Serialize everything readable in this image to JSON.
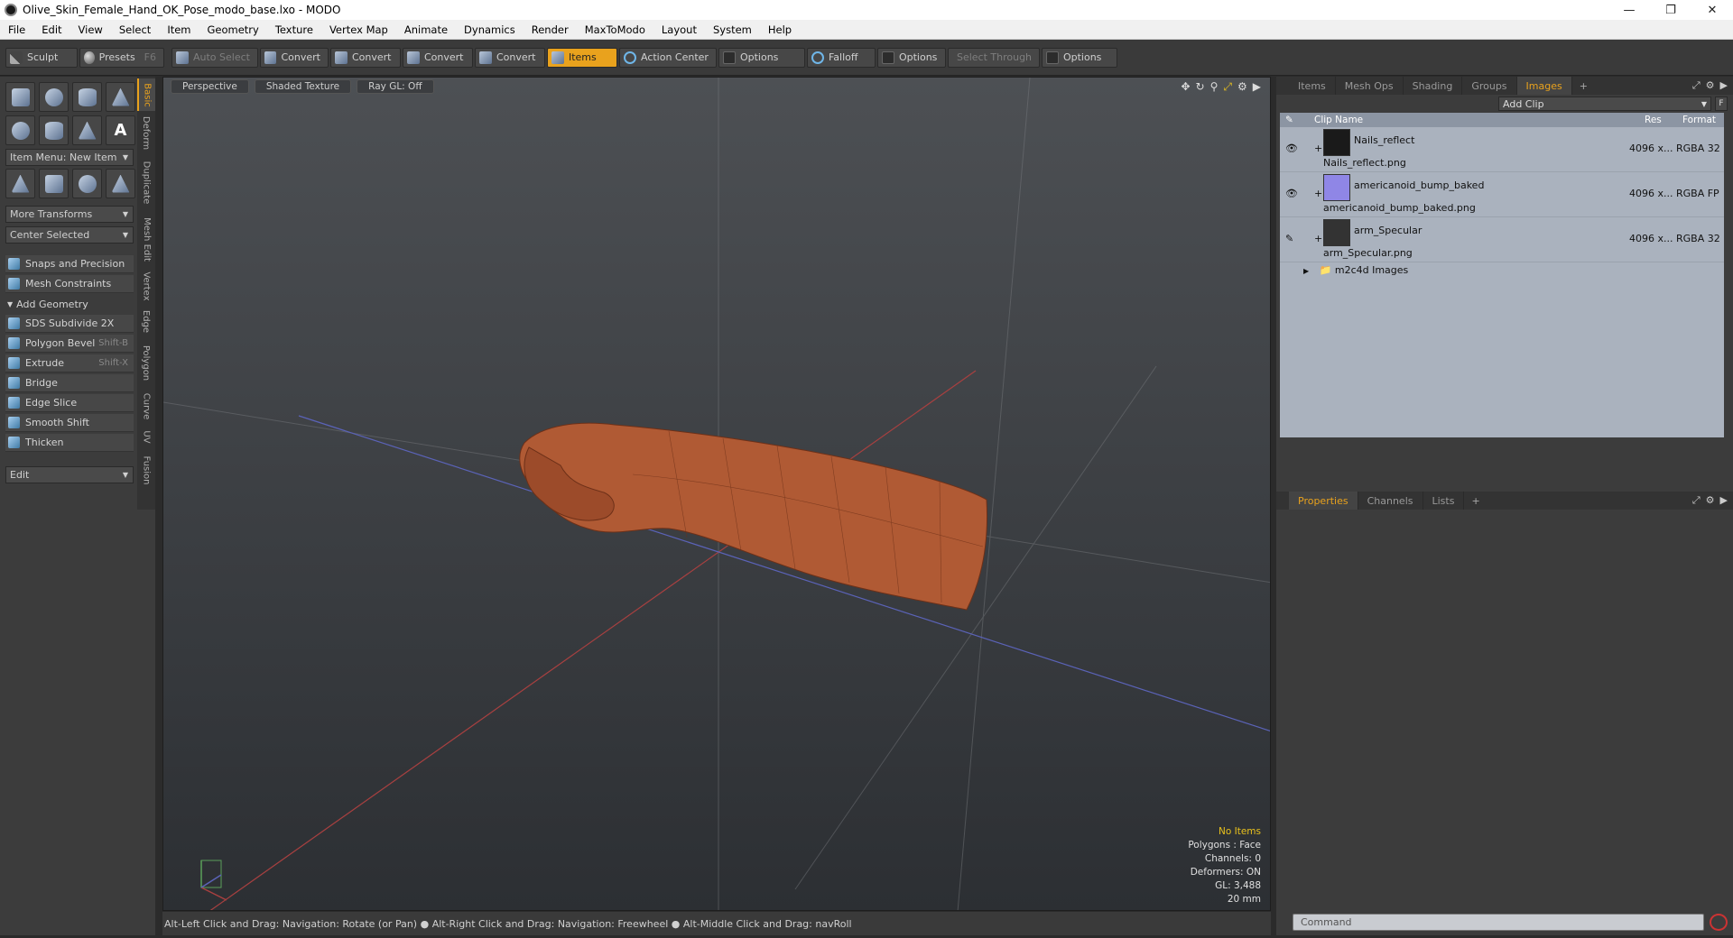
{
  "window": {
    "title": "Olive_Skin_Female_Hand_OK_Pose_modo_base.lxo - MODO"
  },
  "menu": [
    "File",
    "Edit",
    "View",
    "Select",
    "Item",
    "Geometry",
    "Texture",
    "Vertex Map",
    "Animate",
    "Dynamics",
    "Render",
    "MaxToModo",
    "Layout",
    "System",
    "Help"
  ],
  "toolbar": {
    "sculpt": "Sculpt",
    "presets": "Presets",
    "presets_key": "F6",
    "auto_select": "Auto Select",
    "convert1": "Convert",
    "convert2": "Convert",
    "convert3": "Convert",
    "convert4": "Convert",
    "items": "Items",
    "action_center": "Action Center",
    "options1": "Options",
    "falloff": "Falloff",
    "options2": "Options",
    "select_through": "Select Through",
    "options3": "Options"
  },
  "left": {
    "item_menu": "Item Menu: New Item",
    "more_transforms": "More Transforms",
    "center_selected": "Center Selected",
    "snaps": "Snaps and Precision",
    "mesh_constraints": "Mesh Constraints",
    "add_geometry": "Add Geometry",
    "tools": [
      {
        "label": "SDS Subdivide 2X",
        "key": ""
      },
      {
        "label": "Polygon Bevel",
        "key": "Shift-B"
      },
      {
        "label": "Extrude",
        "key": "Shift-X"
      },
      {
        "label": "Bridge",
        "key": ""
      },
      {
        "label": "Edge Slice",
        "key": ""
      },
      {
        "label": "Smooth Shift",
        "key": ""
      },
      {
        "label": "Thicken",
        "key": ""
      }
    ],
    "edit": "Edit",
    "vtabs": [
      "Basic",
      "Deform",
      "Duplicate",
      "Mesh Edit",
      "Vertex",
      "Edge",
      "Polygon",
      "Curve",
      "UV",
      "Fusion"
    ]
  },
  "viewport": {
    "perspective": "Perspective",
    "shaded": "Shaded Texture",
    "raygl": "Ray GL: Off",
    "info": {
      "no_items": "No Items",
      "polygons": "Polygons : Face",
      "channels": "Channels: 0",
      "deformers": "Deformers: ON",
      "gl": "GL: 3,488",
      "scale": "20 mm"
    }
  },
  "status": {
    "hint": "Alt-Left Click and Drag: Navigation: Rotate (or Pan) ● Alt-Right Click and Drag: Navigation: Freewheel ● Alt-Middle Click and Drag: navRoll"
  },
  "right": {
    "top_tabs": [
      "Items",
      "Mesh Ops",
      "Shading",
      "Groups",
      "Images"
    ],
    "add_clip": "Add Clip",
    "f_label": "F",
    "columns": {
      "name": "Clip Name",
      "res": "Res",
      "format": "Format"
    },
    "clips": [
      {
        "name": "Nails_reflect",
        "file": "Nails_reflect.png",
        "res": "4096 x...",
        "format": "RGBA 32"
      },
      {
        "name": "americanoid_bump_baked",
        "file": "americanoid_bump_baked.png",
        "res": "4096 x...",
        "format": "RGBA FP"
      },
      {
        "name": "arm_Specular",
        "file": "arm_Specular.png",
        "res": "4096 x...",
        "format": "RGBA 32"
      }
    ],
    "group": "m2c4d Images",
    "bottom_tabs": [
      "Properties",
      "Channels",
      "Lists"
    ],
    "command_placeholder": "Command"
  },
  "colors": {
    "accent": "#e9a21d",
    "clip_bg": "#aab2be"
  }
}
